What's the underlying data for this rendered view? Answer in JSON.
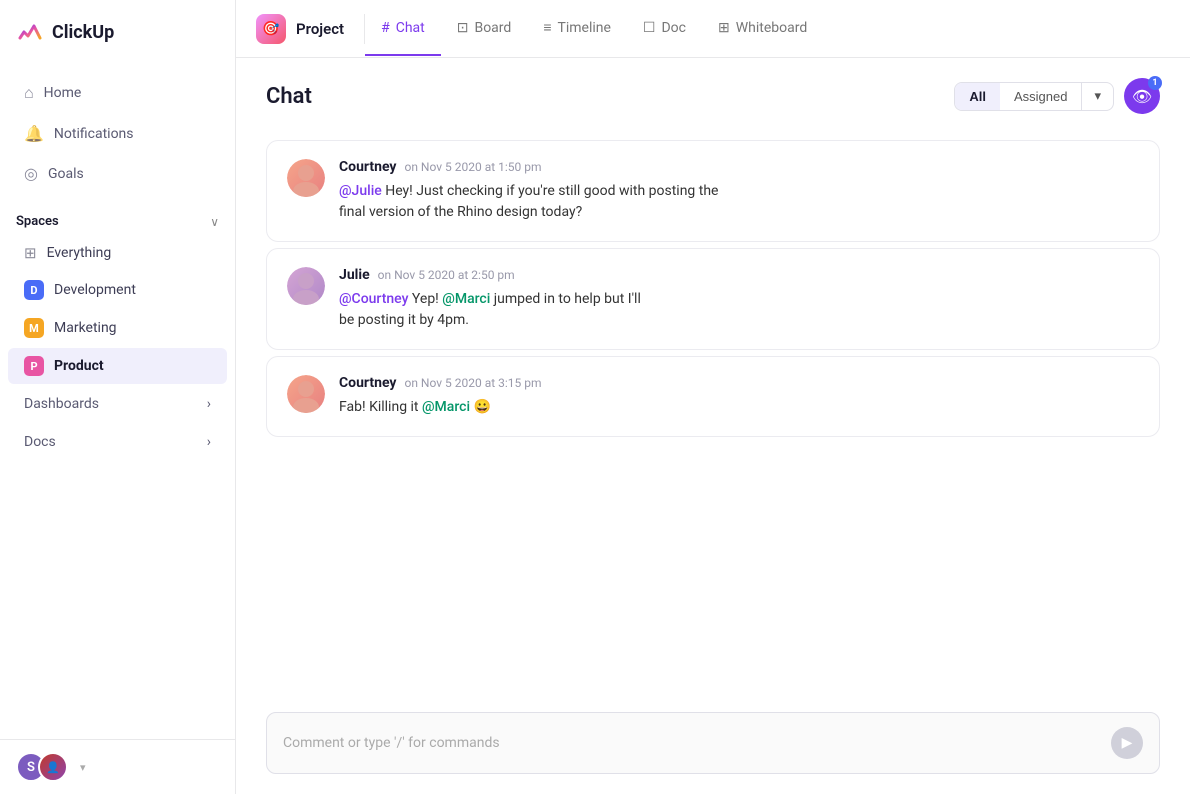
{
  "app": {
    "name": "ClickUp"
  },
  "sidebar": {
    "logo_text": "ClickUp",
    "nav": {
      "home_label": "Home",
      "notifications_label": "Notifications",
      "goals_label": "Goals"
    },
    "spaces_section_label": "Spaces",
    "spaces": [
      {
        "id": "everything",
        "label": "Everything",
        "type": "everything"
      },
      {
        "id": "development",
        "label": "Development",
        "badge": "D",
        "badge_color": "#4a6cf7"
      },
      {
        "id": "marketing",
        "label": "Marketing",
        "badge": "M",
        "badge_color": "#f5a623"
      },
      {
        "id": "product",
        "label": "Product",
        "badge": "P",
        "badge_color": "#e855a3",
        "active": true
      }
    ],
    "dashboards_label": "Dashboards",
    "docs_label": "Docs",
    "bottom": {
      "avatar1_initial": "S",
      "chevron": "▾"
    }
  },
  "topbar": {
    "project_label": "Project",
    "tabs": [
      {
        "id": "chat",
        "label": "Chat",
        "icon": "#",
        "active": true
      },
      {
        "id": "board",
        "label": "Board",
        "icon": "⊡"
      },
      {
        "id": "timeline",
        "label": "Timeline",
        "icon": "≡"
      },
      {
        "id": "doc",
        "label": "Doc",
        "icon": "☐"
      },
      {
        "id": "whiteboard",
        "label": "Whiteboard",
        "icon": "⊞"
      }
    ]
  },
  "chat": {
    "title": "Chat",
    "filter_all": "All",
    "filter_assigned": "Assigned",
    "filter_chevron": "▾",
    "eye_badge_count": "1",
    "messages": [
      {
        "id": "msg1",
        "author": "Courtney",
        "time": "on Nov 5 2020 at 1:50 pm",
        "mention": "@Julie",
        "text_pre": " Hey! Just checking if you're still good with posting the",
        "text_line2": "final version of the Rhino design today?"
      },
      {
        "id": "msg2",
        "author": "Julie",
        "time": "on Nov 5 2020 at 2:50 pm",
        "mention": "@Courtney",
        "text_mid1": " Yep! ",
        "mention2": "@Marci",
        "text_mid2": " jumped in to help but I'll",
        "text_line2": "be posting it by 4pm."
      },
      {
        "id": "msg3",
        "author": "Courtney",
        "time": "on Nov 5 2020 at 3:15 pm",
        "text_pre": "Fab! Killing it ",
        "mention": "@Marci",
        "emoji": "😀"
      }
    ],
    "comment_placeholder": "Comment or type '/' for commands"
  }
}
